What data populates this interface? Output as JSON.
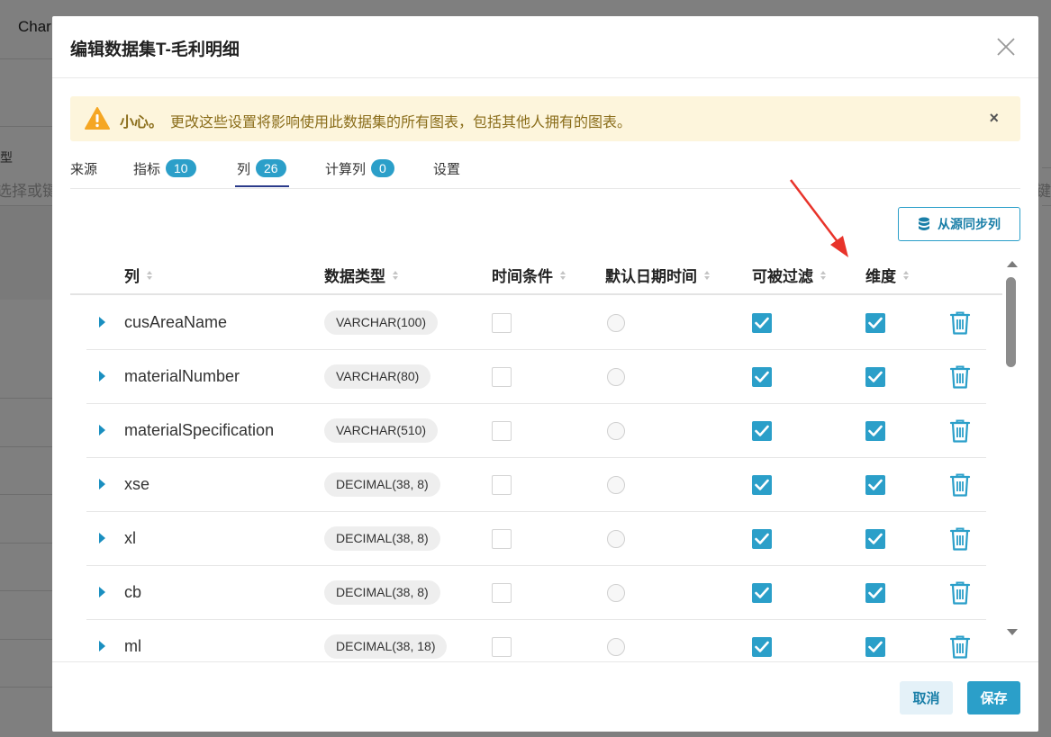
{
  "background": {
    "title_fragment": "Char",
    "label_fragment": "型",
    "input_placeholder_fragment": "选择或键",
    "right_fragment": "或键"
  },
  "modal": {
    "title": "编辑数据集T-毛利明细",
    "close_icon": "close-icon"
  },
  "warning": {
    "strong": "小心。",
    "text": "更改这些设置将影响使用此数据集的所有图表，包括其他人拥有的图表。",
    "close": "×",
    "color": "#fdf5dc"
  },
  "tabs": [
    {
      "label": "来源",
      "badge": ""
    },
    {
      "label": "指标",
      "badge": "10"
    },
    {
      "label": "列",
      "badge": "26",
      "active": true
    },
    {
      "label": "计算列",
      "badge": "0"
    },
    {
      "label": "设置",
      "badge": ""
    }
  ],
  "sync_button": {
    "label": "从源同步列",
    "icon": "database-icon"
  },
  "columns_header": {
    "name": "列",
    "type": "数据类型",
    "temporal": "时间条件",
    "default_datetime": "默认日期时间",
    "filterable": "可被过滤",
    "dimension": "维度"
  },
  "rows": [
    {
      "name": "cusAreaName",
      "type": "VARCHAR(100)",
      "temporal": false,
      "default_datetime": false,
      "filterable": true,
      "dimension": true
    },
    {
      "name": "materialNumber",
      "type": "VARCHAR(80)",
      "temporal": false,
      "default_datetime": false,
      "filterable": true,
      "dimension": true
    },
    {
      "name": "materialSpecification",
      "type": "VARCHAR(510)",
      "temporal": false,
      "default_datetime": false,
      "filterable": true,
      "dimension": true
    },
    {
      "name": "xse",
      "type": "DECIMAL(38, 8)",
      "temporal": false,
      "default_datetime": false,
      "filterable": true,
      "dimension": true
    },
    {
      "name": "xl",
      "type": "DECIMAL(38, 8)",
      "temporal": false,
      "default_datetime": false,
      "filterable": true,
      "dimension": true
    },
    {
      "name": "cb",
      "type": "DECIMAL(38, 8)",
      "temporal": false,
      "default_datetime": false,
      "filterable": true,
      "dimension": true
    },
    {
      "name": "ml",
      "type": "DECIMAL(38, 18)",
      "temporal": false,
      "default_datetime": false,
      "filterable": true,
      "dimension": true
    }
  ],
  "footer": {
    "cancel": "取消",
    "save": "保存"
  },
  "colors": {
    "accent": "#2b9fc9",
    "annotation_arrow": "#e8332a"
  }
}
